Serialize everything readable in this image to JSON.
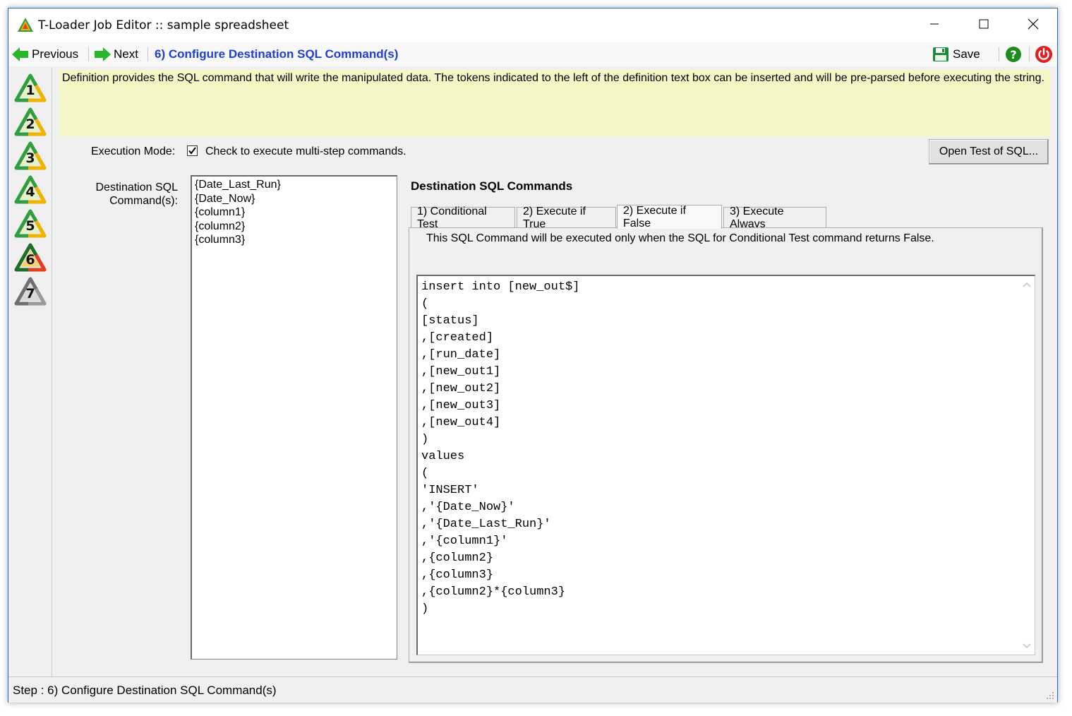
{
  "window": {
    "title": "T-Loader Job Editor :: sample spreadsheet"
  },
  "toolbar": {
    "previous_label": "Previous",
    "next_label": "Next",
    "step_title": "6) Configure Destination SQL Command(s)",
    "save_label": "Save"
  },
  "steps": [
    "1",
    "2",
    "3",
    "4",
    "5",
    "6",
    "7"
  ],
  "definition_text": "Definition provides the SQL command that will write the manipulated data. The tokens indicated to the left of the definition text box can be inserted and will be pre-parsed before executing the string.",
  "execution_mode": {
    "label": "Execution Mode:",
    "checkbox_label": "Check to execute multi-step commands.",
    "checked": true
  },
  "open_test_button": "Open Test of SQL...",
  "destination_label_line1": "Destination SQL",
  "destination_label_line2": "Command(s):",
  "tokens": [
    "{Date_Last_Run}",
    "{Date_Now}",
    "{column1}",
    "{column2}",
    "{column3}"
  ],
  "section_title": "Destination SQL Commands",
  "tabs": [
    {
      "label": "1) Conditional Test",
      "active": false
    },
    {
      "label": "2) Execute if True",
      "active": false
    },
    {
      "label": "2) Execute if False",
      "active": true
    },
    {
      "label": "3) Execute Always",
      "active": false
    }
  ],
  "tab_description": "This SQL Command will be executed only when the SQL for Conditional Test command returns False.",
  "sql_text": "insert into [new_out$]\n(\n[status]\n,[created]\n,[run_date]\n,[new_out1]\n,[new_out2]\n,[new_out3]\n,[new_out4]\n)\nvalues\n(\n'INSERT'\n,'{Date_Now}'\n,'{Date_Last_Run}'\n,'{column1}'\n,{column2}\n,{column3}\n,{column2}*{column3}\n)",
  "status_bar": "Step : 6) Configure Destination SQL Command(s)",
  "colors": {
    "accent_blue": "#1e3fd6",
    "definition_bg": "#f5f5c6",
    "help_green": "#1e8c1e",
    "power_red": "#e02020"
  }
}
